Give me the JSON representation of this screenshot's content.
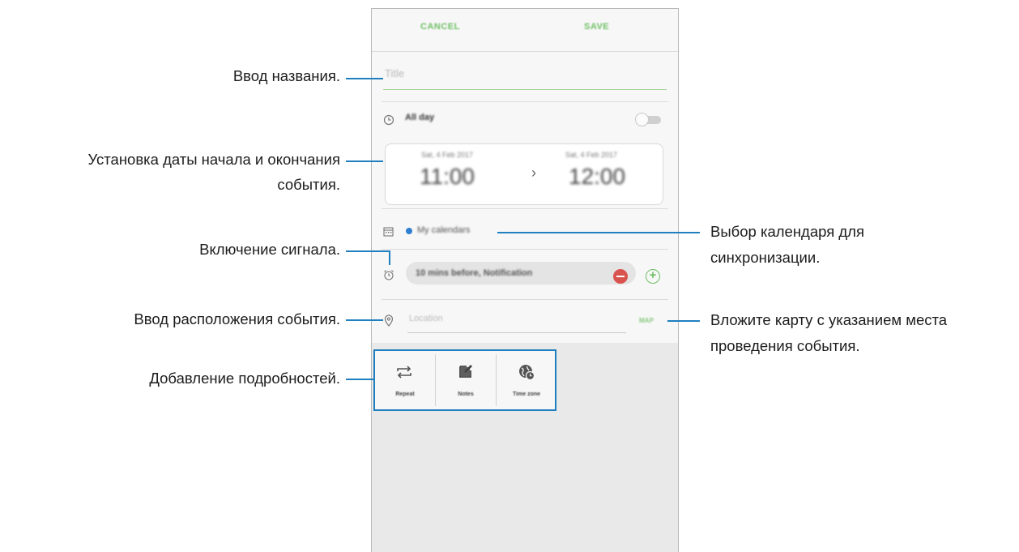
{
  "colors": {
    "accent_green": "#6fbf65",
    "callout_blue": "#1f7fbf",
    "calendar_dot": "#2d7fd0",
    "remove_red": "#d9534f"
  },
  "phone": {
    "cancel_label": "CANCEL",
    "save_label": "SAVE",
    "title_placeholder": "Title",
    "all_day_label": "All day",
    "start": {
      "date": "Sat, 4 Feb 2017",
      "time": "11:00"
    },
    "end": {
      "date": "Sat, 4 Feb 2017",
      "time": "12:00"
    },
    "calendar_name": "My calendars",
    "reminder": "10 mins before, Notification",
    "location_placeholder": "Location",
    "map_label": "MAP",
    "add_options": [
      {
        "label": "Repeat",
        "icon": "repeat-icon"
      },
      {
        "label": "Notes",
        "icon": "notes-icon"
      },
      {
        "label": "Time zone",
        "icon": "time-zone-icon"
      }
    ]
  },
  "callouts": {
    "title": "Ввод названия.",
    "dates_line1": "Установка даты начала и окончания",
    "dates_line2": "события.",
    "alarm": "Включение сигнала.",
    "location": "Ввод расположения события.",
    "details": "Добавление подробностей.",
    "calendar_line1": "Выбор календаря для",
    "calendar_line2": "синхронизации.",
    "map_line1": "Вложите карту с указанием места",
    "map_line2": "проведения события."
  }
}
